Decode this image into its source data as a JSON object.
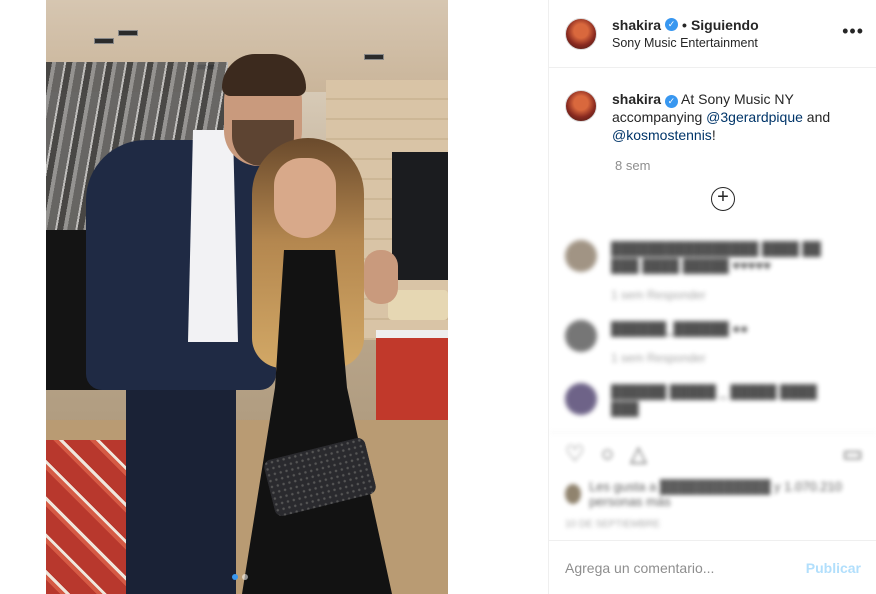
{
  "post": {
    "username": "shakira",
    "verified_mark": "✓",
    "follow_separator": "•",
    "follow_status": "Siguiendo",
    "location": "Sony Music Entertainment",
    "more_icon": "•••"
  },
  "caption": {
    "username": "shakira",
    "text_before": " At Sony Music NY accompanying ",
    "mention1": "@3gerardpique",
    "text_middle": " and ",
    "mention2": "@kosmostennis",
    "text_after": "!",
    "time_ago": "8 sem"
  },
  "load_more_icon": "+",
  "comments": [
    {
      "text": "████████████████ ████ ██ ███ ████ █████ ♥♥♥♥♥",
      "meta": "1 sem     Responder"
    },
    {
      "text": "██████_██████ ●●",
      "meta": "1 sem     Responder"
    },
    {
      "text": "██████ █████ _ █████ ████ ███",
      "meta": ""
    }
  ],
  "actions": {
    "like_icon": "♡",
    "comment_icon": "○",
    "share_icon": "△",
    "bookmark_icon": "▭",
    "likes_text": "Les gusta a ████████████ y 1.070.210 personas más",
    "date": "10 DE SEPTIEMBRE"
  },
  "comment_box": {
    "placeholder": "Agrega un comentario...",
    "publish_label": "Publicar"
  },
  "colors": {
    "verified_blue": "#3897f0",
    "publish_disabled": "#b2dffc",
    "mention": "#003569"
  }
}
